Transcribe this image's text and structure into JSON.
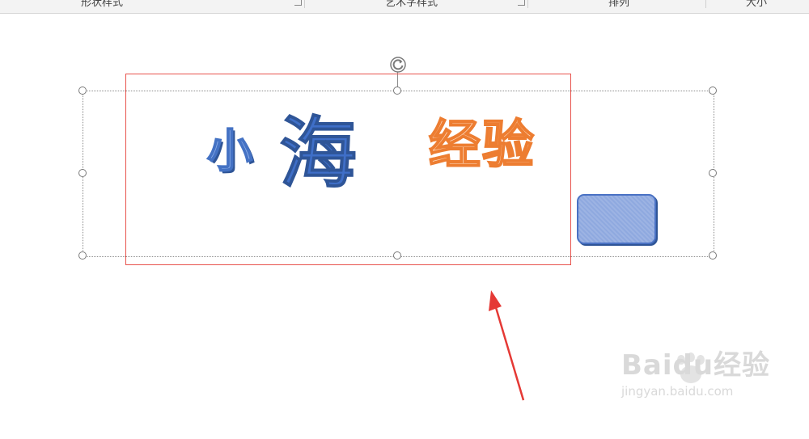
{
  "ribbon": {
    "groups": [
      {
        "label": "形状样式"
      },
      {
        "label": "艺术字样式"
      },
      {
        "label": "排列"
      },
      {
        "label": "大小"
      }
    ]
  },
  "canvas": {
    "wordart": {
      "xiao": "小",
      "hai": "海",
      "jingyan": "经验"
    },
    "colors": {
      "red_highlight": "#e8534d",
      "blue_text": "#3f6fc8",
      "orange_outline": "#ed7d31",
      "shape_fill": "#8fa9df",
      "arrow": "#e53935"
    }
  },
  "watermark": {
    "brand": "Bai",
    "brand2": "du",
    "brand_cn": "经验",
    "url": "jingyan.baidu.com"
  }
}
